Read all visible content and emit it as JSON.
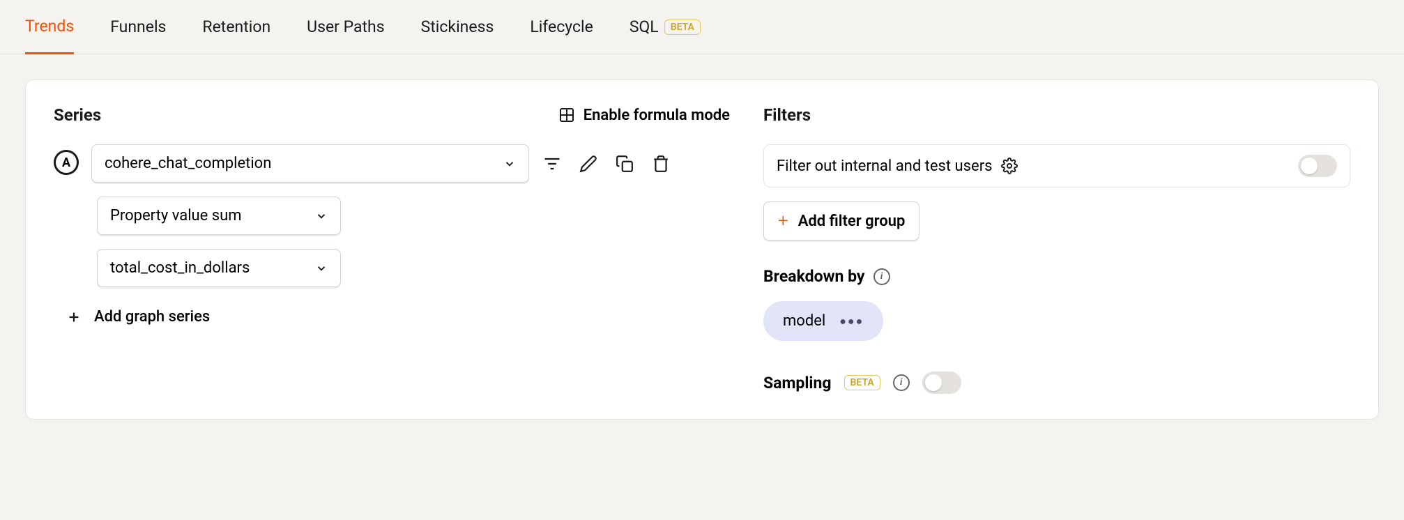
{
  "tabs": [
    {
      "label": "Trends",
      "active": true
    },
    {
      "label": "Funnels"
    },
    {
      "label": "Retention"
    },
    {
      "label": "User Paths"
    },
    {
      "label": "Stickiness"
    },
    {
      "label": "Lifecycle"
    },
    {
      "label": "SQL",
      "badge": "BETA"
    }
  ],
  "series": {
    "title": "Series",
    "formula_label": "Enable formula mode",
    "items": [
      {
        "letter": "A",
        "event": "cohere_chat_completion",
        "aggregation": "Property value sum",
        "property": "total_cost_in_dollars"
      }
    ],
    "add_label": "Add graph series"
  },
  "filters": {
    "title": "Filters",
    "internal_label": "Filter out internal and test users",
    "add_label": "Add filter group"
  },
  "breakdown": {
    "title": "Breakdown by",
    "pill": "model"
  },
  "sampling": {
    "title": "Sampling",
    "badge": "BETA"
  }
}
